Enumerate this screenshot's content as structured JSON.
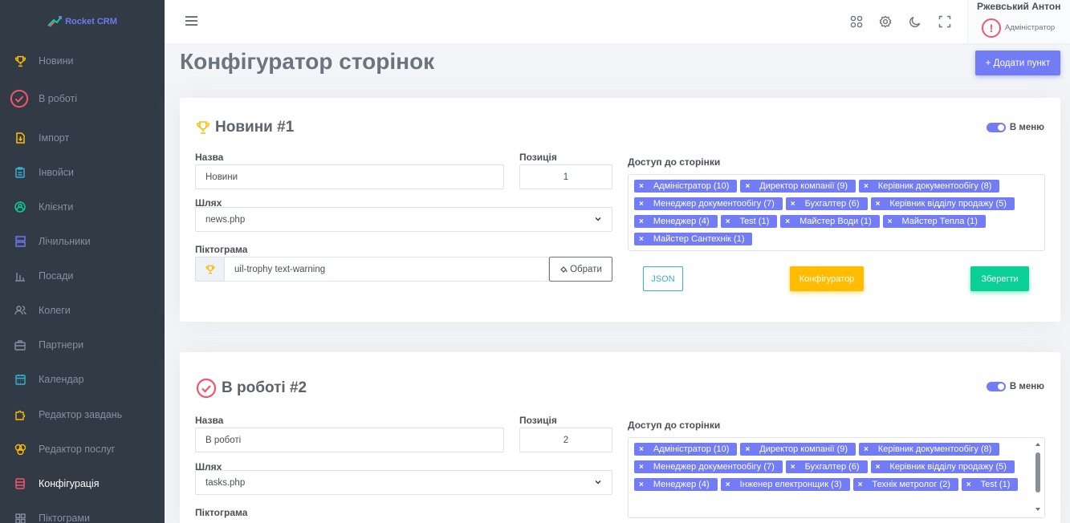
{
  "brand": {
    "name": "Rocket CRM",
    "logo_icon": "rocket-icon"
  },
  "sidebar": {
    "items": [
      {
        "label": "Новини",
        "icon": "trophy-icon",
        "color": "#ffbc00"
      },
      {
        "label": "В роботі",
        "icon": "check-circle-icon",
        "color": "#f1556c"
      },
      {
        "label": "Імпорт",
        "icon": "file-import-icon",
        "color": "#ffbc00"
      },
      {
        "label": "Інвойси",
        "icon": "clipboard-icon",
        "color": "#39afd1"
      },
      {
        "label": "Клієнти",
        "icon": "user-circle-icon",
        "color": "#0acf97"
      },
      {
        "label": "Лічильники",
        "icon": "server-icon",
        "color": "#727cf5"
      },
      {
        "label": "Посади",
        "icon": "chart-bar-icon",
        "color": "#8391a2"
      },
      {
        "label": "Колеги",
        "icon": "users-icon",
        "color": "#8391a2"
      },
      {
        "label": "Партнери",
        "icon": "briefcase-icon",
        "color": "#8391a2"
      },
      {
        "label": "Календар",
        "icon": "calendar-icon",
        "color": "#39afd1"
      },
      {
        "label": "Редактор завдань",
        "icon": "puzzle-icon",
        "color": "#ffbc00"
      },
      {
        "label": "Редактор послуг",
        "icon": "atom-icon",
        "color": "#ffbc00"
      },
      {
        "label": "Конфігурація",
        "icon": "database-icon",
        "color": "#f1556c",
        "active": true
      },
      {
        "label": "Піктограми",
        "icon": "icons-icon",
        "color": "#8391a2"
      }
    ]
  },
  "topbar": {
    "icons": [
      "apps-icon",
      "settings-icon",
      "moon-icon",
      "fullscreen-icon"
    ],
    "user": {
      "name": "Ржевський Антон",
      "role": "Адміністратор"
    }
  },
  "page": {
    "title": "Конфігуратор сторінок",
    "add_button": "+ Додати пункт"
  },
  "labels": {
    "name": "Назва",
    "position": "Позиція",
    "path": "Шлях",
    "icon": "Піктограма",
    "access": "Доступ до сторінки",
    "in_menu": "В меню",
    "choose": "Обрати",
    "json": "JSON",
    "configurator": "Конфігуратор",
    "save": "Зберегти"
  },
  "cards": [
    {
      "title": "Новини #1",
      "icon": "trophy-icon",
      "icon_color": "#ffbc00",
      "name": "Новини",
      "position": "1",
      "path": "news.php",
      "icon_class": "uil-trophy text-warning",
      "access": [
        "Адміністратор (10)",
        "Директор компанії (9)",
        "Керівник документообігу (8)",
        "Менеджер документообігу (7)",
        "Бухгалтер (6)",
        "Керівник відділу продажу (5)",
        "Менеджер (4)",
        "Test (1)",
        "Майстер Води (1)",
        "Майстер Тепла (1)",
        "Майстер Сантехнік (1)"
      ]
    },
    {
      "title": "В роботі #2",
      "icon": "check-circle-icon",
      "icon_color": "#f1556c",
      "name": "В роботі",
      "position": "2",
      "path": "tasks.php",
      "access": [
        "Адміністратор (10)",
        "Директор компанії (9)",
        "Керівник документообігу (8)",
        "Менеджер документообігу (7)",
        "Бухгалтер (6)",
        "Керівник відділу продажу (5)",
        "Менеджер (4)",
        "Інженер електронщик (3)",
        "Технік метролог (2)",
        "Test (1)"
      ]
    }
  ]
}
